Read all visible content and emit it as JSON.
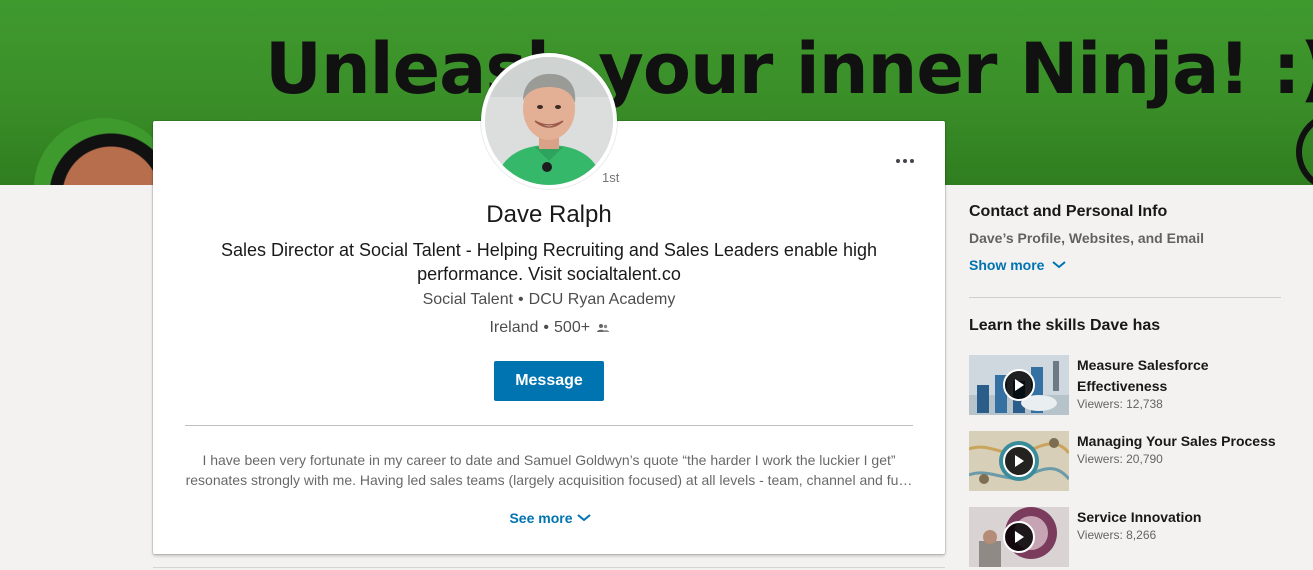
{
  "banner": {
    "text": "Unleash your inner Ninja! :)",
    "color": "#3f9a2e"
  },
  "profile": {
    "name": "Dave Ralph",
    "degree": "1st",
    "headline": "Sales Director at Social Talent - Helping Recruiting and Sales Leaders enable high performance. Visit socialtalent.co",
    "company": "Social Talent",
    "school": "DCU Ryan Academy",
    "location": "Ireland",
    "connections": "500+",
    "message_label": "Message",
    "summary_line1": "I have been very fortunate in my career to date and Samuel Goldwyn’s quote “the harder I work the luckier I get”",
    "summary_line2": "resonates strongly with me. Having led sales teams (largely acquisition focused) at all levels - team, channel and fu…",
    "see_more_label": "See more",
    "separator": "•"
  },
  "contact": {
    "title": "Contact and Personal Info",
    "subtitle": "Dave’s Profile, Websites, and Email",
    "show_more_label": "Show more"
  },
  "learning": {
    "title": "Learn the skills Dave has",
    "courses": [
      {
        "title": "Measure Salesforce Effectiveness",
        "viewers": "Viewers: 12,738"
      },
      {
        "title": "Managing Your Sales Process",
        "viewers": "Viewers: 20,790"
      },
      {
        "title": "Service Innovation",
        "viewers": "Viewers: 8,266"
      }
    ]
  },
  "colors": {
    "accent": "#0073b1",
    "page_bg": "#f3f2f0",
    "card_bg": "#ffffff"
  }
}
